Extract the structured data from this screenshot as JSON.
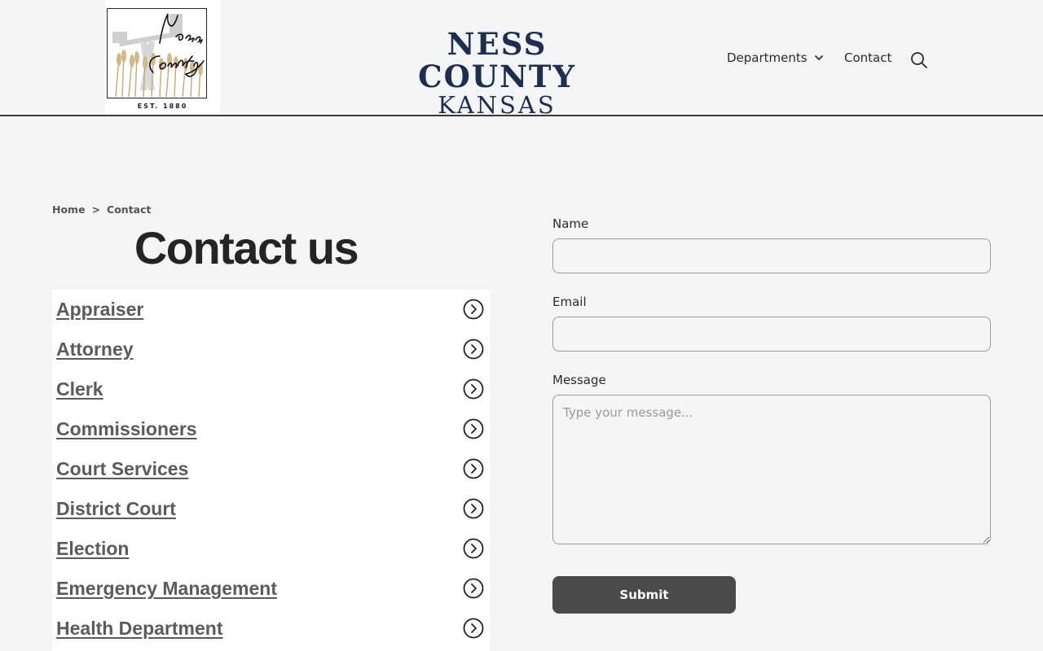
{
  "header": {
    "logo": {
      "script_text": "Ness County",
      "est_label": "EST. 1880"
    },
    "title_line1": "NESS COUNTY",
    "title_line2": "KANSAS",
    "nav": {
      "departments_label": "Departments",
      "contact_label": "Contact"
    }
  },
  "breadcrumb": {
    "home": "Home",
    "separator": ">",
    "current": "Contact"
  },
  "page_title": "Contact us",
  "departments": [
    {
      "label": "Appraiser"
    },
    {
      "label": "Attorney"
    },
    {
      "label": "Clerk"
    },
    {
      "label": "Commissioners"
    },
    {
      "label": "Court Services"
    },
    {
      "label": "District Court"
    },
    {
      "label": "Election"
    },
    {
      "label": "Emergency Management"
    },
    {
      "label": "Health Department"
    }
  ],
  "form": {
    "name_label": "Name",
    "name_value": "",
    "email_label": "Email",
    "email_value": "",
    "message_label": "Message",
    "message_placeholder": "Type your message...",
    "submit_label": "Submit"
  },
  "icons": {
    "dept_arrow": "circle-chevron-right-icon",
    "nav_dropdown": "chevron-down-icon",
    "search": "search-icon"
  },
  "colors": {
    "background": "#f4f5f7",
    "title_navy": "#1f2d4e",
    "submit_bg": "#4a4a4a",
    "link_gray": "#5b5b5b"
  }
}
